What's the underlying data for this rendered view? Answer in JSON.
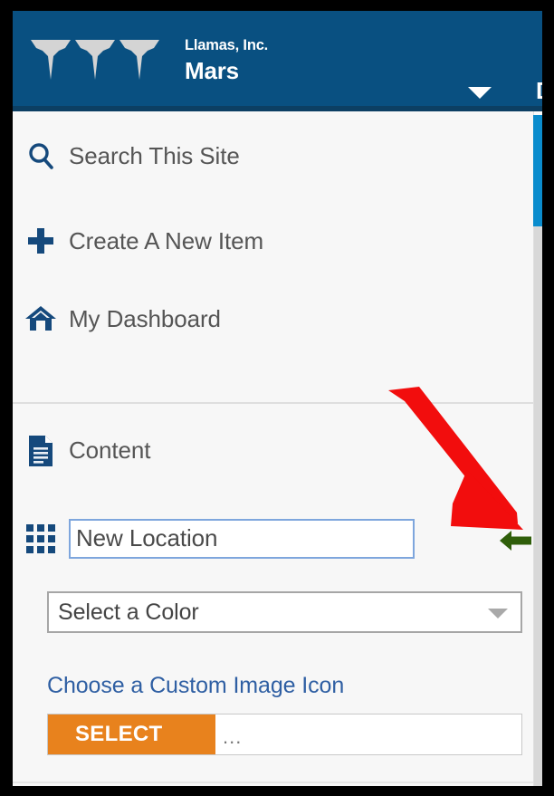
{
  "window": {
    "frame_color": "#000000",
    "background": "#f7f7f7"
  },
  "header": {
    "background_color": "#095081",
    "logo_icon": "triple-chevron-logo",
    "org_name": "Llamas, Inc.",
    "site_name": "Mars",
    "dropdown_icon": "caret-down-icon",
    "cut_off_text": "D"
  },
  "menu": {
    "items": [
      {
        "icon": "search-icon",
        "label": "Search This Site"
      },
      {
        "icon": "plus-icon",
        "label": "Create A New Item"
      },
      {
        "icon": "home-icon",
        "label": "My Dashboard"
      },
      {
        "icon": "document-icon",
        "label": "Content"
      }
    ],
    "icon_color": "#15497c",
    "label_color": "#555555"
  },
  "location_row": {
    "icon": "grid-3x3-icon",
    "input_value": "New Location",
    "input_placeholder": "New Location",
    "submit_icon": "arrow-left-icon",
    "submit_icon_color": "#2f5e0a",
    "input_focus_border": "#7ea6dd"
  },
  "color_select": {
    "selected_value": "Select a Color",
    "caret_icon": "caret-down-icon",
    "border_color": "#a6a6a6"
  },
  "custom_image": {
    "label": "Choose a Custom Image Icon",
    "label_color": "#2f5fa3",
    "select_button_label": "SELECT",
    "select_button_color": "#e8821d",
    "file_name": "..."
  },
  "scrollbar": {
    "thumb_color": "#0a8ccd",
    "track_color": "#d8d8d8"
  },
  "annotation": {
    "arrow_icon": "red-pointer-arrow",
    "arrow_color": "#f20d0d"
  }
}
